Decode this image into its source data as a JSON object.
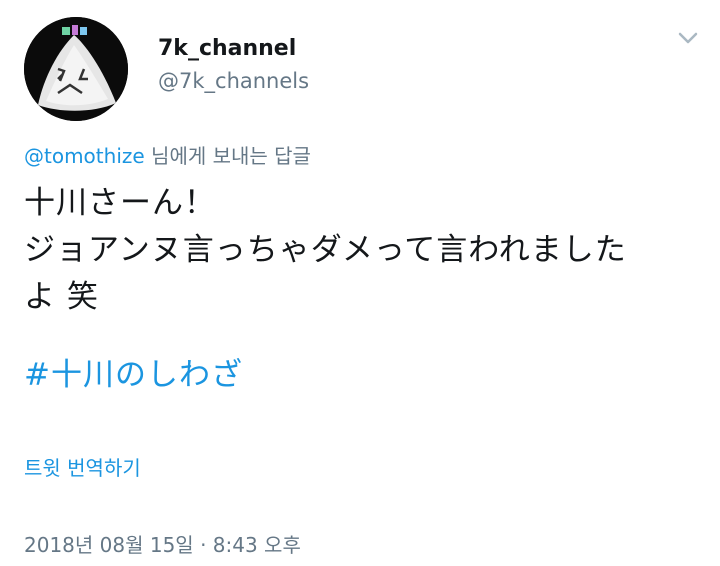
{
  "author": {
    "display_name": "7k_channel",
    "handle": "@7k_channels",
    "avatar": "onigiri-ghost-avatar"
  },
  "menu": {
    "icon": "chevron-down-icon"
  },
  "reply": {
    "mention": "@tomothize",
    "suffix": " 님에게 보내는 답글"
  },
  "tweet": {
    "lines": [
      "十川さーん！",
      "ジョアンヌ言っちゃダメって言われました",
      "よ 笑"
    ],
    "hashtag": "#十川のしわざ"
  },
  "translate_label": "트윗 번역하기",
  "timestamp": "2018년 08월 15일 · 8:43 오후",
  "colors": {
    "link": "#1b95e0",
    "secondary_text": "#657786",
    "primary_text": "#14171a"
  }
}
